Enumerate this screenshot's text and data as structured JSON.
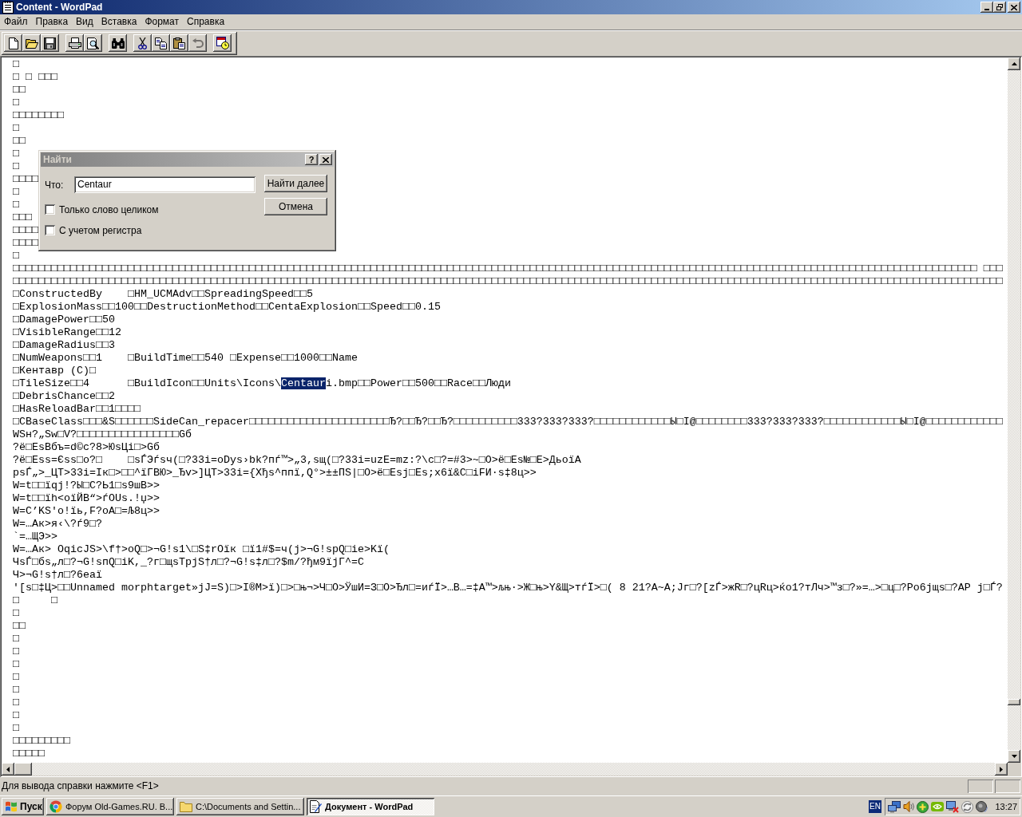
{
  "window": {
    "title": "Content - WordPad",
    "active": true
  },
  "menu": [
    "Файл",
    "Правка",
    "Вид",
    "Вставка",
    "Формат",
    "Справка"
  ],
  "toolbar": [
    [
      {
        "kind": "new",
        "disabled": false
      },
      {
        "kind": "open",
        "disabled": false
      },
      {
        "kind": "save",
        "disabled": false
      }
    ],
    [
      {
        "kind": "print",
        "disabled": false
      },
      {
        "kind": "preview",
        "disabled": false
      }
    ],
    [
      {
        "kind": "find",
        "disabled": false
      }
    ],
    [
      {
        "kind": "cut",
        "disabled": false
      },
      {
        "kind": "copy",
        "disabled": false
      },
      {
        "kind": "paste",
        "disabled": false
      },
      {
        "kind": "undo",
        "disabled": true
      }
    ],
    [
      {
        "kind": "datetime",
        "disabled": false
      }
    ]
  ],
  "document": {
    "lines": [
      [
        {
          "text": "□",
          "selected": false
        }
      ],
      [
        {
          "text": "□ □ □□□",
          "selected": false
        }
      ],
      [
        {
          "text": "□□",
          "selected": false
        }
      ],
      [
        {
          "text": "□",
          "selected": false
        }
      ],
      [
        {
          "text": "□□□□□□□□",
          "selected": false
        }
      ],
      [
        {
          "text": "□",
          "selected": false
        }
      ],
      [
        {
          "text": "□□",
          "selected": false
        }
      ],
      [
        {
          "text": "□",
          "selected": false
        }
      ],
      [
        {
          "text": "□",
          "selected": false
        }
      ],
      [
        {
          "text": "□□□□",
          "selected": false
        }
      ],
      [
        {
          "text": "□",
          "selected": false
        }
      ],
      [
        {
          "text": "□",
          "selected": false
        }
      ],
      [
        {
          "text": "□□□",
          "selected": false
        }
      ],
      [
        {
          "text": "□□□□",
          "selected": false
        }
      ],
      [
        {
          "text": "□□□□",
          "selected": false
        }
      ],
      [
        {
          "text": "□",
          "selected": false
        }
      ],
      [
        {
          "text": "□□□□□□□□□□□□□□□□□□□□□□□□□□□□□□□□□□□□□□□□□□□□□□□□□□□□□□□□□□□□□□□□□□□□□□□□□□□□□□□□□□□□□□□□□□□□□□□□□□□□□□□□□□□□□□□□□□□□□□□□□□□□□□□□□□□□□□□□□□□□□□□□□□□□□□□ □□□",
          "selected": false
        }
      ],
      [
        {
          "text": "□□□□□□□□□□□□□□□□□□□□□□□□□□□□□□□□□□□□□□□□□□□□□□□□□□□□□□□□□□□□□□□□□□□□□□□□□□□□□□□□□□□□□□□□□□□□□□□□□□□□□□□□□□□□□□□□□□□□□□□□□□□□□□□□□□□□□□□□□□□□□□□□□□□□□□□□□□□",
          "selected": false
        }
      ],
      [
        {
          "text": "□ConstructedBy    □HM_UCMAdv□□SpreadingSpeed□□5",
          "selected": false
        }
      ],
      [
        {
          "text": "□ExplosionMass□□100□□DestructionMethod□□CentaExplosion□□Speed□□0.15",
          "selected": false
        }
      ],
      [
        {
          "text": "□DamagePower□□50",
          "selected": false
        }
      ],
      [
        {
          "text": "□VisibleRange□□12",
          "selected": false
        }
      ],
      [
        {
          "text": "□DamageRadius□□3",
          "selected": false
        }
      ],
      [
        {
          "text": "□NumWeapons□□1    □BuildTime□□540 □Expense□□1000□□Name",
          "selected": false
        }
      ],
      [
        {
          "text": "□Кентавр (C)□",
          "selected": false
        }
      ],
      [
        {
          "text": "□TileSize□□4      □BuildIcon□□Units\\Icons\\",
          "selected": false
        },
        {
          "text": "Centaur",
          "selected": true
        },
        {
          "text": "i.bmp□□Power□□500□□Race□□Люди",
          "selected": false
        }
      ],
      [
        {
          "text": "□DebrisChance□□2",
          "selected": false
        }
      ],
      [
        {
          "text": "□HasReloadBar□□1□□□□",
          "selected": false
        }
      ],
      [
        {
          "text": "□CBaseClass□□□&S□□□□□□SideCan_repacer□□□□□□□□□□□□□□□□□□□□□□Ђ?□□Ђ?□□Ђ?□□□□□□□□□□333?333?333?□□□□□□□□□□□□Ы□I@□□□□□□□□333?333?333?□□□□□□□□□□□□Ы□I@□□□□□□□□□□□□",
          "selected": false
        }
      ],
      [
        {
          "text": "WSн?„Sw□V?□□□□□□□□□□□□□□□□Gб",
          "selected": false
        }
      ],
      [
        {
          "text": "?ё□EsВбъ=d©c?8>ЮsЦi□>Gб",
          "selected": false
        }
      ],
      [
        {
          "text": "?ё□Ess=Єss□o?□    □sЃЭѓsч(□?33i=oDys›bk?пѓ™>„3,sщ(□?33i=uzE=mz:?\\c□?=#3>~□O>ё□Es№□E>ДьoїA",
          "selected": false
        }
      ],
      [
        {
          "text": "psЃ„>_ЦТ>33i=Iк□>□□^їГВЮ>_Ђv>]ЦТ>33i={Xђs^ппї,Q°>±±ПS|□O>ё□Esj□Es;x6ї&C□iFИ·s‡8ц>>",
          "selected": false
        }
      ],
      [
        {
          "text": "W=t□□їqj!?Ы□C?Ь1□s9шВ>>",
          "selected": false
        }
      ],
      [
        {
          "text": "W=t□□їh<oїЙВ“>ѓOUs.!џ>>",
          "selected": false
        }
      ],
      [
        {
          "text": "W=C’KS'o!їь,F?oА□=Љ8ц>>",
          "selected": false
        }
      ],
      [
        {
          "text": "W=…Ак>я‹\\?ѓ9□?",
          "selected": false
        }
      ],
      [
        {
          "text": "`=…ЩЭ>>",
          "selected": false
        }
      ],
      [
        {
          "text": "W=…Ак> OqicJS>\\f†>oQ□>¬G!s1\\□S‡rOїк □ї1#$=ч(j>¬G!spQ□ie>Kї(",
          "selected": false
        }
      ],
      [
        {
          "text": "ЧsЃ□бs„л□?¬G!sпQ□iK,_?г□щsTpjS†л□?¬G!s‡л□?$m/?ђм9їјГ^=C",
          "selected": false
        }
      ],
      [
        {
          "text": "Ч>¬G!s†л□?6eaї",
          "selected": false
        }
      ],
      [
        {
          "text": "'[s□‡Ц>□□Unnamed morphtarget»jJ=S)□>I®M>ї)□>□њ¬>Ч□O>ЎшИ=З□O>Ђл□=иѓЇ>…В…=‡А™>љњ·>Ж□њ>Y&Щ>тѓЇ>□( 8 21?А~А;Јг□?[zЃ>жR□?цRц>ќo1?тЛч>™з□?»=…>□ц□?Po6jщs□?AP j□Ѓ?",
          "selected": false
        }
      ],
      [
        {
          "text": "□     □",
          "selected": false
        }
      ],
      [
        {
          "text": "□",
          "selected": false
        }
      ],
      [
        {
          "text": "□□",
          "selected": false
        }
      ],
      [
        {
          "text": "□",
          "selected": false
        }
      ],
      [
        {
          "text": "□",
          "selected": false
        }
      ],
      [
        {
          "text": "□",
          "selected": false
        }
      ],
      [
        {
          "text": "□",
          "selected": false
        }
      ],
      [
        {
          "text": "□",
          "selected": false
        }
      ],
      [
        {
          "text": "□",
          "selected": false
        }
      ],
      [
        {
          "text": "□",
          "selected": false
        }
      ],
      [
        {
          "text": "□",
          "selected": false
        }
      ],
      [
        {
          "text": "□□□□□□□□□",
          "selected": false
        }
      ],
      [
        {
          "text": "□□□□□",
          "selected": false
        }
      ]
    ]
  },
  "find_dialog": {
    "title": "Найти",
    "active": false,
    "help_button": "?",
    "find_label": "Что:",
    "find_value": "Centaur",
    "options": [
      {
        "label": "Только слово целиком",
        "checked": false
      },
      {
        "label": "С учетом регистра",
        "checked": false
      }
    ],
    "buttons": [
      "Найти далее",
      "Отмена"
    ]
  },
  "status_bar": {
    "text": "Для вывода справки нажмите <F1>"
  },
  "taskbar": {
    "start": "Пуск",
    "tasks": [
      {
        "kind": "browser",
        "label": "Форум Old-Games.RU. В...",
        "selected": false
      },
      {
        "kind": "folder",
        "label": "C:\\Documents and Settin...",
        "selected": false
      },
      {
        "kind": "document",
        "label": "Документ - WordPad",
        "selected": true
      }
    ],
    "language": "EN",
    "clock": "13:27"
  }
}
